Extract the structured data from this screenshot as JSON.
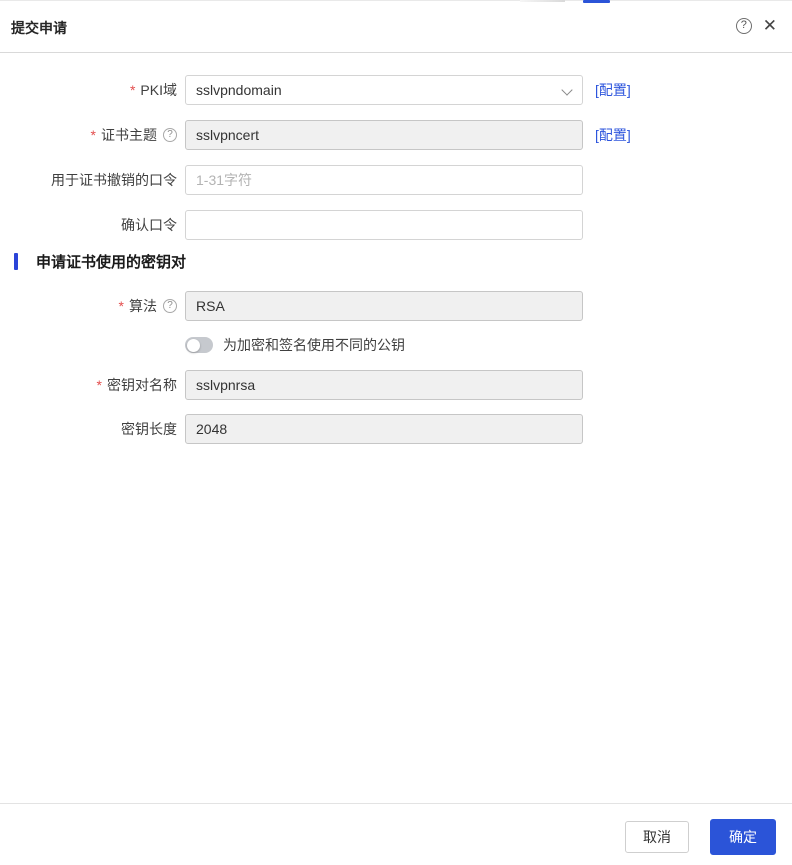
{
  "colors": {
    "accent_blue": "#2b54d8",
    "link_blue": "#2d55dd",
    "required_red": "#e34d4d",
    "section_bar_blue": "#2b44d8",
    "disabled_bg": "#f0f0f0"
  },
  "header": {
    "title": "提交申请",
    "help_glyph": "?",
    "close_glyph": "✕"
  },
  "required_mark": "*",
  "form": {
    "pki_domain": {
      "label": "PKI域",
      "value": "sslvpndomain",
      "config_link": "[配置]"
    },
    "cert_subject": {
      "label": "证书主题",
      "help_glyph": "?",
      "value": "sslvpncert",
      "config_link": "[配置]"
    },
    "revoke_password": {
      "label": "用于证书撤销的口令",
      "value": "",
      "placeholder": "1-31字符"
    },
    "confirm_password": {
      "label": "确认口令",
      "value": "",
      "placeholder": ""
    },
    "keypair_section_title": "申请证书使用的密钥对",
    "algorithm": {
      "label": "算法",
      "help_glyph": "?",
      "value": "RSA"
    },
    "separate_keys_toggle": {
      "state": "off",
      "label": "为加密和签名使用不同的公钥"
    },
    "keypair_name": {
      "label": "密钥对名称",
      "value": "sslvpnrsa"
    },
    "key_length": {
      "label": "密钥长度",
      "value": "2048"
    }
  },
  "footer": {
    "cancel_label": "取消",
    "ok_label": "确定"
  }
}
